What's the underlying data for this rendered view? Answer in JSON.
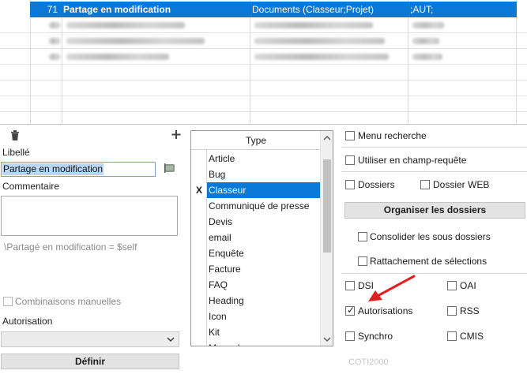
{
  "grid": {
    "selected_row": {
      "id": "71",
      "name": "Partage en modification",
      "types": "Documents (Classeur;Projet)",
      "rights": ";AUT;"
    }
  },
  "left": {
    "libelle_label": "Libellé",
    "libelle_value": "Partage en modification",
    "commentaire_label": "Commentaire",
    "commentaire_value": "",
    "formula": "\\Partagé en modification = $self",
    "combinaisons_label": "Combinaisons manuelles",
    "autorisation_label": "Autorisation",
    "autorisation_value": "",
    "definir_label": "Définir"
  },
  "type_list": {
    "header": "Type",
    "items": [
      {
        "label": "Article",
        "mark": ""
      },
      {
        "label": "Bug",
        "mark": ""
      },
      {
        "label": "Classeur",
        "mark": "X",
        "selected": true
      },
      {
        "label": "Communiqué de presse",
        "mark": ""
      },
      {
        "label": "Devis",
        "mark": ""
      },
      {
        "label": "email",
        "mark": ""
      },
      {
        "label": "Enquête",
        "mark": ""
      },
      {
        "label": "Facture",
        "mark": ""
      },
      {
        "label": "FAQ",
        "mark": ""
      },
      {
        "label": "Heading",
        "mark": ""
      },
      {
        "label": "Icon",
        "mark": ""
      },
      {
        "label": "Kit",
        "mark": ""
      },
      {
        "label": "Manuel",
        "mark": ""
      }
    ]
  },
  "options": {
    "menu_recherche": {
      "label": "Menu recherche",
      "checked": false
    },
    "champ_requete": {
      "label": "Utiliser en champ-requête",
      "checked": false
    },
    "dossiers": {
      "label": "Dossiers",
      "checked": false
    },
    "dossier_web": {
      "label": "Dossier WEB",
      "checked": false
    },
    "organiser_label": "Organiser les dossiers",
    "consolider": {
      "label": "Consolider les sous dossiers",
      "checked": false
    },
    "rattachement": {
      "label": "Rattachement de sélections",
      "checked": false
    },
    "dsi": {
      "label": "DSI",
      "checked": false
    },
    "oai": {
      "label": "OAI",
      "checked": false
    },
    "autorisations": {
      "label": "Autorisations",
      "checked": true
    },
    "rss": {
      "label": "RSS",
      "checked": false
    },
    "synchro": {
      "label": "Synchro",
      "checked": false
    },
    "cmis": {
      "label": "CMIS",
      "checked": false
    },
    "footer_text": "COTI2000"
  },
  "colors": {
    "selection": "#0a78d7",
    "annotation_arrow": "#e02020"
  }
}
